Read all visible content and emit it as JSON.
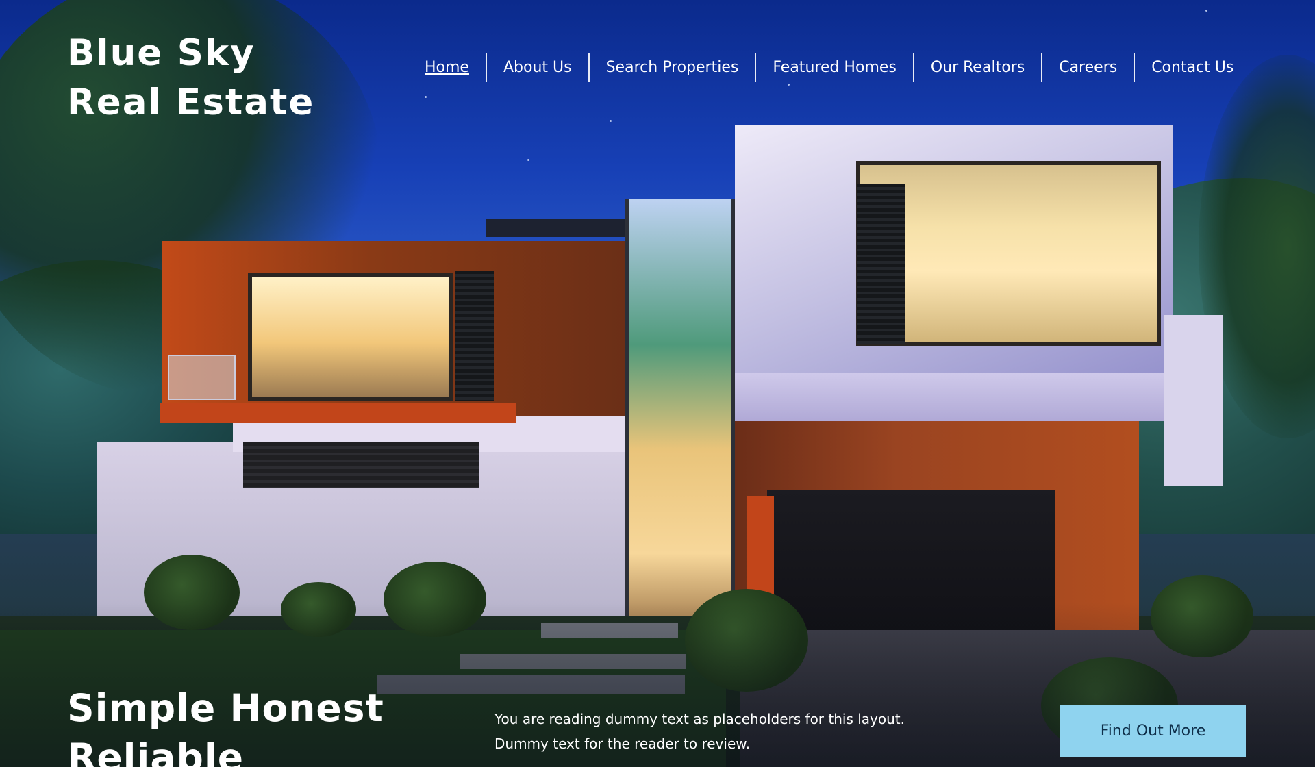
{
  "brand": {
    "line1": "Blue Sky",
    "line2": "Real Estate"
  },
  "nav": {
    "items": [
      {
        "label": "Home",
        "active": true
      },
      {
        "label": "About Us",
        "active": false
      },
      {
        "label": "Search Properties",
        "active": false
      },
      {
        "label": "Featured Homes",
        "active": false
      },
      {
        "label": "Our Realtors",
        "active": false
      },
      {
        "label": "Careers",
        "active": false
      },
      {
        "label": "Contact Us",
        "active": false
      }
    ]
  },
  "hero": {
    "image_icon": "modern-house-night-photo",
    "tagline_line1": "Simple Honest",
    "tagline_line2": "Reliable",
    "blurb_line1": "You are reading dummy text as placeholders for this layout.",
    "blurb_line2": "Dummy text for the reader to review.",
    "cta_label": "Find Out More"
  },
  "colors": {
    "cta_background": "#8fd3ef",
    "cta_text": "#0f2f4a",
    "text": "#ffffff"
  }
}
